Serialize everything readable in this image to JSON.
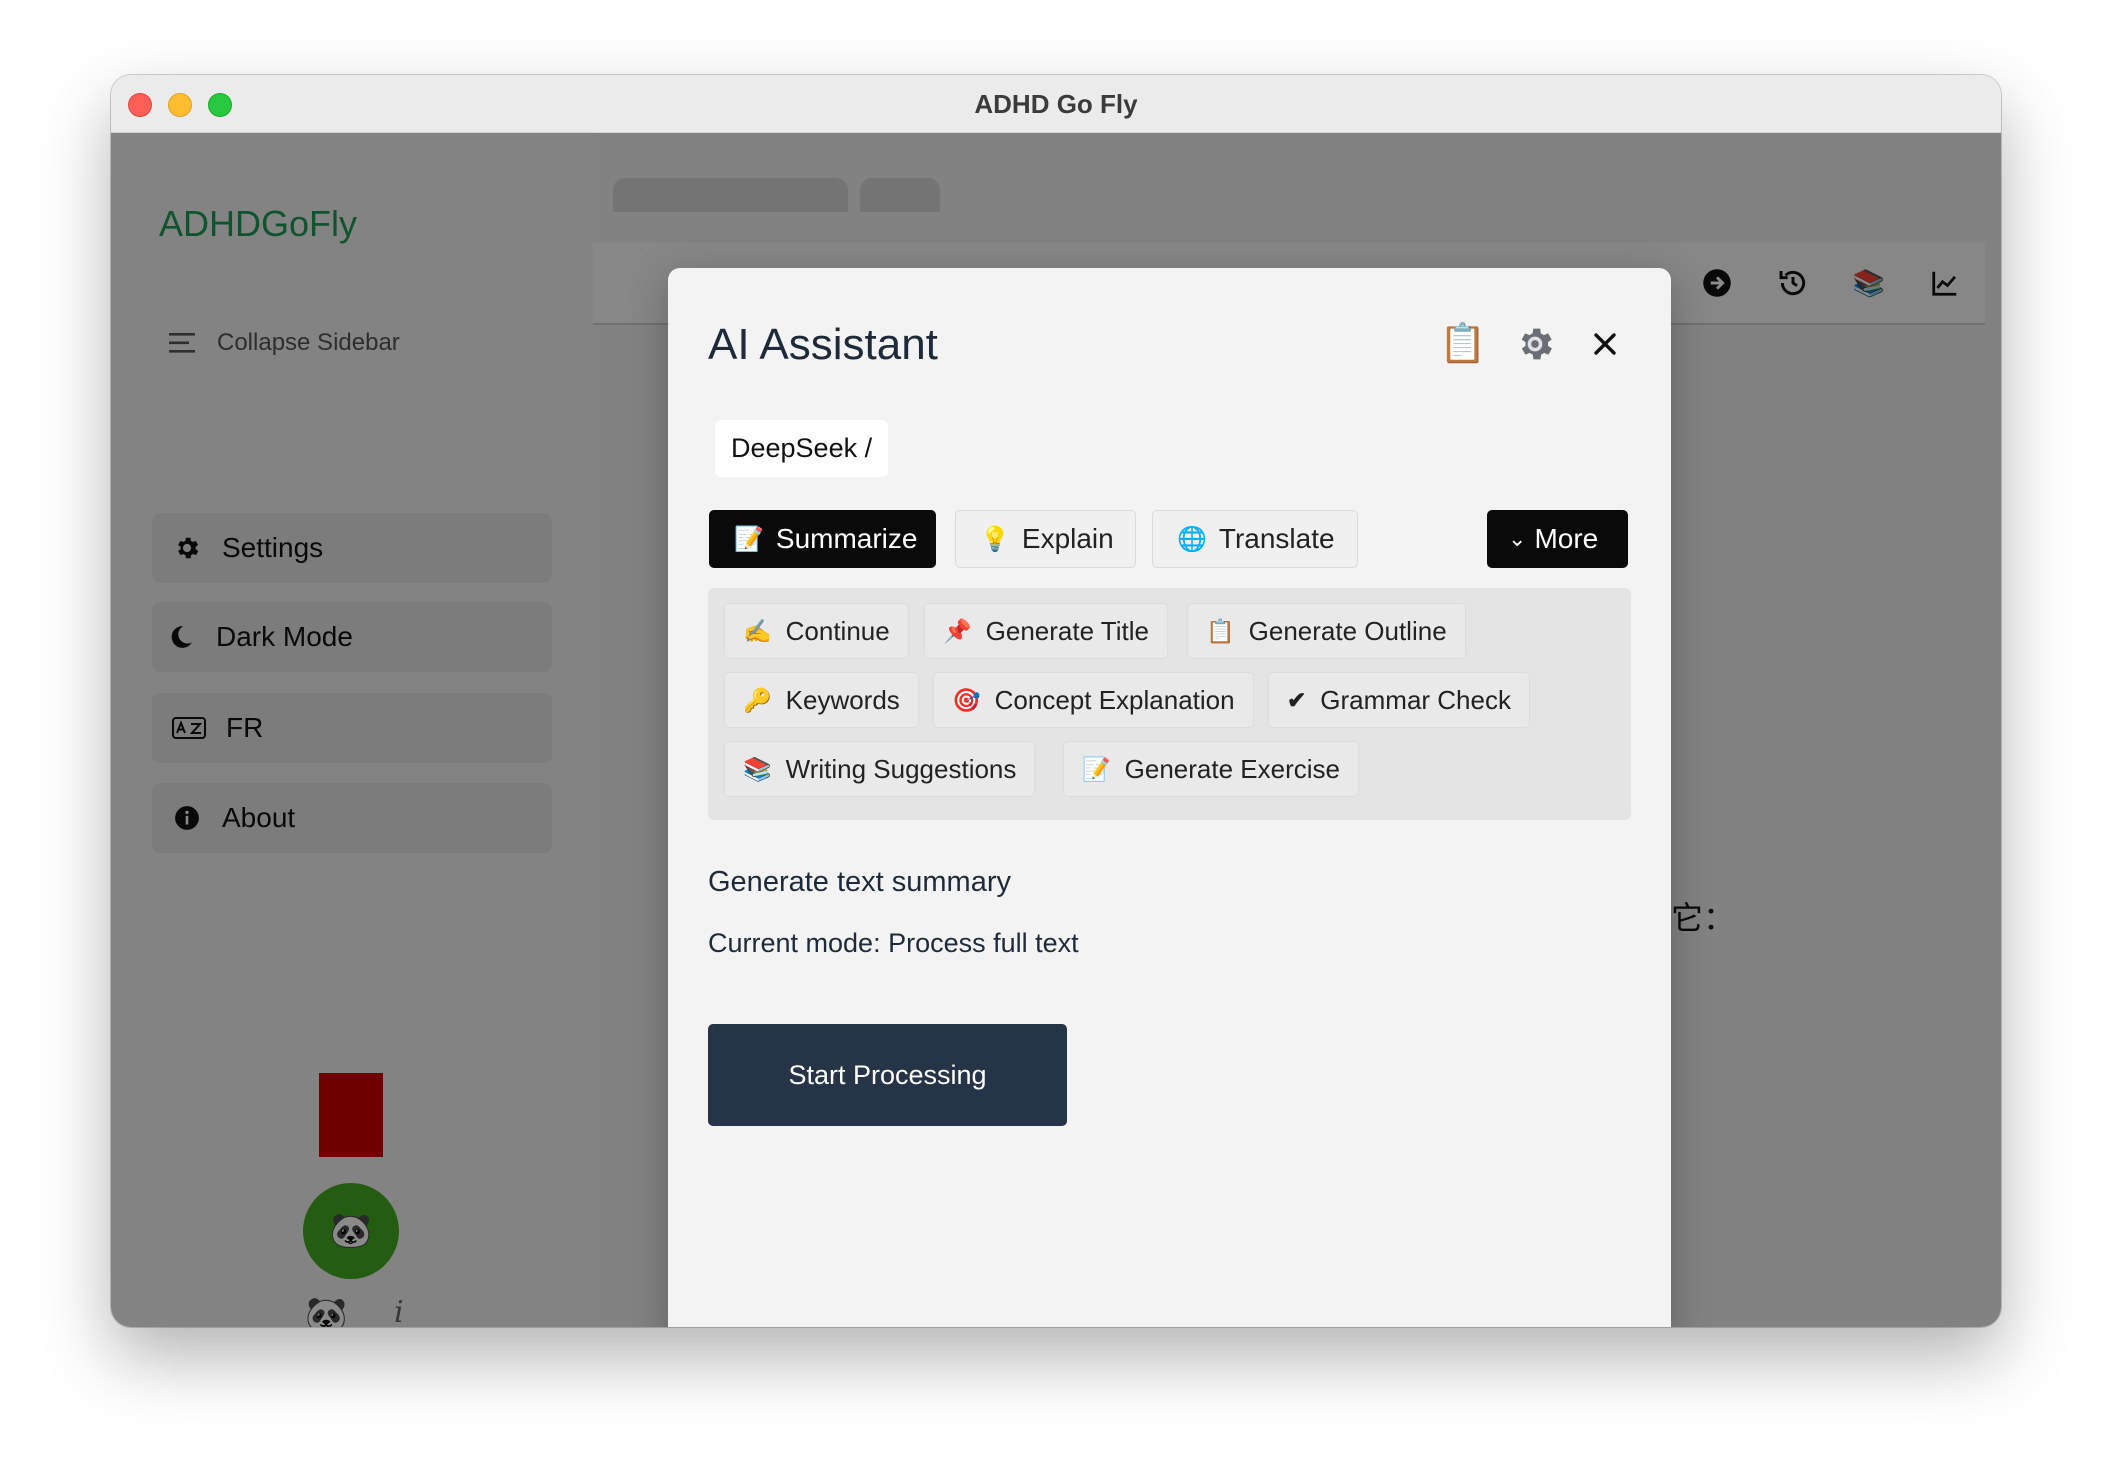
{
  "window": {
    "title": "ADHD Go Fly"
  },
  "sidebar": {
    "brand": "ADHDGoFly",
    "collapse_label": "Collapse Sidebar",
    "items": [
      {
        "label": "Settings",
        "icon": "gear-icon"
      },
      {
        "label": "Dark Mode",
        "icon": "moon-icon"
      },
      {
        "label": "FR",
        "icon": "language-icon"
      },
      {
        "label": "About",
        "icon": "info-icon"
      }
    ],
    "panda_emoji": "🐼",
    "panda_small_emoji": "🐼",
    "info_glyph": "i",
    "colors": {
      "brand": "#1f9a57",
      "red_block": "#cc0000",
      "panda_circle": "#44aa22"
    }
  },
  "main": {
    "toolbar_icons": [
      "arrow-right-circle-icon",
      "history-icon",
      "books-icon",
      "chart-icon",
      "outline-icon"
    ],
    "partial_text": "它："
  },
  "modal": {
    "title": "AI Assistant",
    "header_icons": [
      "clipboard-icon",
      "gear-icon",
      "close-icon"
    ],
    "model_label": "DeepSeek /",
    "tabs": [
      {
        "emoji": "📝",
        "label": "Summarize",
        "active": true
      },
      {
        "emoji": "💡",
        "label": "Explain",
        "active": false
      },
      {
        "emoji": "🌐",
        "label": "Translate",
        "active": false
      }
    ],
    "more_label": "More",
    "more_icon": "⌄",
    "more_options": [
      {
        "emoji": "✍️",
        "label": "Continue"
      },
      {
        "emoji": "📌",
        "label": "Generate Title"
      },
      {
        "emoji": "📋",
        "label": "Generate Outline"
      },
      {
        "emoji": "🔑",
        "label": "Keywords"
      },
      {
        "emoji": "🎯",
        "label": "Concept Explanation"
      },
      {
        "emoji": "✔",
        "label": "Grammar Check"
      },
      {
        "emoji": "📚",
        "label": "Writing Suggestions"
      },
      {
        "emoji": "📝",
        "label": "Generate Exercise"
      }
    ],
    "description": "Generate text summary",
    "mode_text": "Current mode: Process full text",
    "start_button": "Start Processing",
    "colors": {
      "active_tab": "#0a0a0a",
      "start_button": "#253446"
    }
  }
}
